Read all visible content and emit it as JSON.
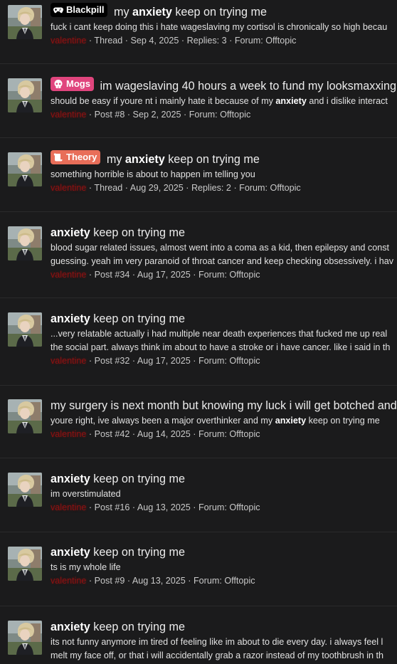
{
  "results": [
    {
      "prefix": {
        "label": "Blackpill",
        "icon": "gamepad-icon",
        "bg": "#000000"
      },
      "title": {
        "pre": "my ",
        "keyword": "anxiety",
        "post": " keep on trying me"
      },
      "snippet": {
        "pre": "fuck i cant keep doing this i hate wageslaving my cortisol is chronically so high becau",
        "keyword": "",
        "post": ""
      },
      "snippet2": "",
      "user": "valentine",
      "type": "Thread",
      "date": "Sep 4, 2025",
      "replies": "Replies: 3",
      "forum": "Forum: Offtopic"
    },
    {
      "prefix": {
        "label": "Mogs",
        "icon": "skull-icon",
        "bg": "#e0457d"
      },
      "title": {
        "pre": "im wageslaving 40 hours a week to fund my looksmaxxing",
        "keyword": "",
        "post": ""
      },
      "snippet": {
        "pre": "should be easy if youre nt i mainly hate it because of my ",
        "keyword": "anxiety",
        "post": " and i dislike interact"
      },
      "snippet2": "",
      "user": "valentine",
      "type": "Post #8",
      "date": "Sep 2, 2025",
      "replies": "",
      "forum": "Forum: Offtopic"
    },
    {
      "prefix": {
        "label": "Theory",
        "icon": "scroll-icon",
        "bg": "#e86e59"
      },
      "title": {
        "pre": "my ",
        "keyword": "anxiety",
        "post": " keep on trying me"
      },
      "snippet": {
        "pre": "something horrible is about to happen im telling you",
        "keyword": "",
        "post": ""
      },
      "snippet2": "",
      "user": "valentine",
      "type": "Thread",
      "date": "Aug 29, 2025",
      "replies": "Replies: 2",
      "forum": "Forum: Offtopic"
    },
    {
      "prefix": null,
      "title": {
        "pre": "",
        "keyword": "anxiety",
        "post": " keep on trying me"
      },
      "snippet": {
        "pre": "blood sugar related issues, almost went into a coma as a kid, then epilepsy and const",
        "keyword": "",
        "post": ""
      },
      "snippet2": "guessing. yeah im very paranoid of throat cancer and keep checking obsessively. i hav",
      "user": "valentine",
      "type": "Post #34",
      "date": "Aug 17, 2025",
      "replies": "",
      "forum": "Forum: Offtopic"
    },
    {
      "prefix": null,
      "title": {
        "pre": "",
        "keyword": "anxiety",
        "post": " keep on trying me"
      },
      "snippet": {
        "pre": "...very relatable actually i had multiple near death experiences that fucked me up real",
        "keyword": "",
        "post": ""
      },
      "snippet2": "the social part. always think im about to have a stroke or i have cancer. like i said in th",
      "user": "valentine",
      "type": "Post #32",
      "date": "Aug 17, 2025",
      "replies": "",
      "forum": "Forum: Offtopic"
    },
    {
      "prefix": null,
      "title": {
        "pre": "my surgery is next month but knowing my luck i will get botched and",
        "keyword": "",
        "post": ""
      },
      "snippet": {
        "pre": "youre right, ive always been a major overthinker and my ",
        "keyword": "anxiety",
        "post": " keep on trying me"
      },
      "snippet2": "",
      "user": "valentine",
      "type": "Post #42",
      "date": "Aug 14, 2025",
      "replies": "",
      "forum": "Forum: Offtopic"
    },
    {
      "prefix": null,
      "title": {
        "pre": "",
        "keyword": "anxiety",
        "post": " keep on trying me"
      },
      "snippet": {
        "pre": "im overstimulated",
        "keyword": "",
        "post": ""
      },
      "snippet2": "",
      "user": "valentine",
      "type": "Post #16",
      "date": "Aug 13, 2025",
      "replies": "",
      "forum": "Forum: Offtopic"
    },
    {
      "prefix": null,
      "title": {
        "pre": "",
        "keyword": "anxiety",
        "post": " keep on trying me"
      },
      "snippet": {
        "pre": "ts is my whole life",
        "keyword": "",
        "post": ""
      },
      "snippet2": "",
      "user": "valentine",
      "type": "Post #9",
      "date": "Aug 13, 2025",
      "replies": "",
      "forum": "Forum: Offtopic"
    },
    {
      "prefix": null,
      "title": {
        "pre": "",
        "keyword": "anxiety",
        "post": " keep on trying me"
      },
      "snippet": {
        "pre": "its not funny anymore im tired of feeling like im about to die every day. i always feel l",
        "keyword": "",
        "post": ""
      },
      "snippet2": "melt my face off, or that i will accidentally grab a razor instead of my toothbrush in th",
      "user": "",
      "type": "",
      "date": "",
      "replies": "",
      "forum": ""
    }
  ],
  "separator": " · "
}
